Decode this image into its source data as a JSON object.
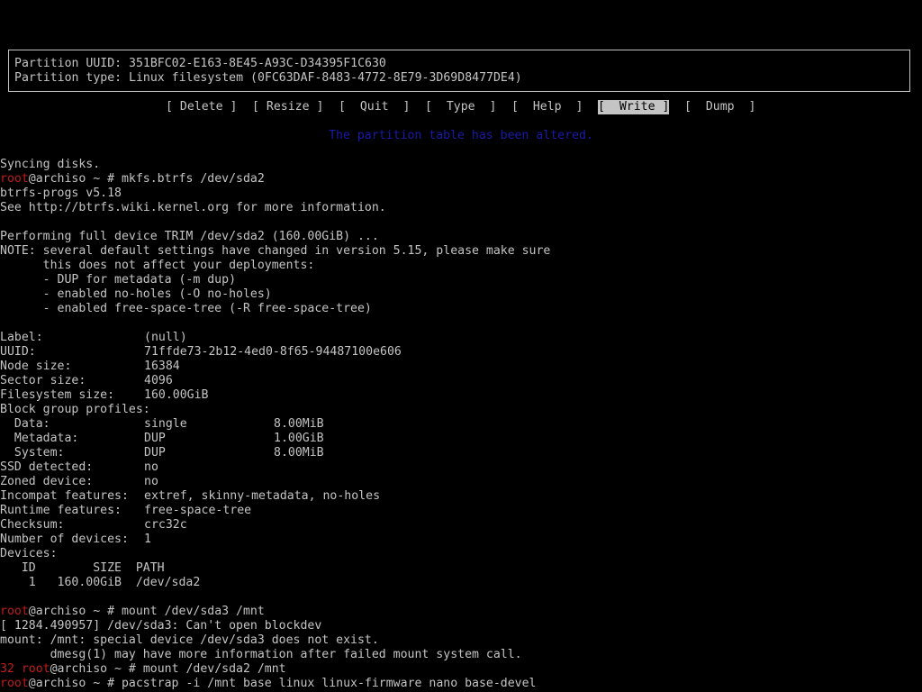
{
  "colors": {
    "background": "#000000",
    "text": "#c4c4c4",
    "prompt_user": "#c01c1c",
    "status": "#1a1aa8",
    "selected_button_bg": "#c4c4c4"
  },
  "partition_box": {
    "uuid_line": "Partition UUID: 351BFC02-E163-8E45-A93C-D34395F1C630",
    "type_line": "Partition type: Linux filesystem (0FC63DAF-8483-4772-8E79-3D69D8477DE4)"
  },
  "menu": {
    "buttons": [
      "[ Delete ]",
      "[ Resize ]",
      "[  Quit  ]",
      "[  Type  ]",
      "[  Help  ]",
      "[  Write ]",
      "[  Dump  ]"
    ],
    "selected": "Write"
  },
  "status_message": "The partition table has been altered.",
  "terminal": {
    "syncing": "Syncing disks.",
    "prompt_user": "root",
    "prompt_host": "@archiso ~ # ",
    "cmd_mkfs": "mkfs.btrfs /dev/sda2",
    "btrfs_version": "btrfs-progs v5.18",
    "see_info": "See http://btrfs.wiki.kernel.org for more information.",
    "trim": "Performing full device TRIM /dev/sda2 (160.00GiB) ...",
    "note_lines": [
      "NOTE: several default settings have changed in version 5.15, please make sure",
      "      this does not affect your deployments:",
      "      - DUP for metadata (-m dup)",
      "      - enabled no-holes (-O no-holes)",
      "      - enabled free-space-tree (-R free-space-tree)"
    ],
    "fs_info": [
      {
        "label": "Label:",
        "value": "(null)"
      },
      {
        "label": "UUID:",
        "value": "71ffde73-2b12-4ed0-8f65-94487100e606"
      },
      {
        "label": "Node size:",
        "value": "16384"
      },
      {
        "label": "Sector size:",
        "value": "4096"
      },
      {
        "label": "Filesystem size:",
        "value": "160.00GiB"
      },
      {
        "label": "Block group profiles:",
        "value": ""
      }
    ],
    "profiles": [
      {
        "label": "  Data:",
        "type": "single",
        "size": "8.00MiB"
      },
      {
        "label": "  Metadata:",
        "type": "DUP",
        "size": "1.00GiB"
      },
      {
        "label": "  System:",
        "type": "DUP",
        "size": "8.00MiB"
      }
    ],
    "fs_info2": [
      {
        "label": "SSD detected:",
        "value": "no"
      },
      {
        "label": "Zoned device:",
        "value": "no"
      },
      {
        "label": "Incompat features:",
        "value": "extref, skinny-metadata, no-holes"
      },
      {
        "label": "Runtime features:",
        "value": "free-space-tree"
      },
      {
        "label": "Checksum:",
        "value": "crc32c"
      },
      {
        "label": "Number of devices:",
        "value": "1"
      },
      {
        "label": "Devices:",
        "value": ""
      }
    ],
    "devices_header": "   ID        SIZE  PATH",
    "devices_row": "    1   160.00GiB  /dev/sda2",
    "cmd_mount1": "mount /dev/sda3 /mnt",
    "mount_err1": "[ 1284.490957] /dev/sda3: Can't open blockdev",
    "mount_err2": "mount: /mnt: special device /dev/sda3 does not exist.",
    "mount_err3": "       dmesg(1) may have more information after failed mount system call.",
    "exit_code": "32 ",
    "cmd_mount2": "mount /dev/sda2 /mnt",
    "cmd_pacstrap": "pacstrap -i /mnt base linux linux-firmware nano base-devel"
  }
}
